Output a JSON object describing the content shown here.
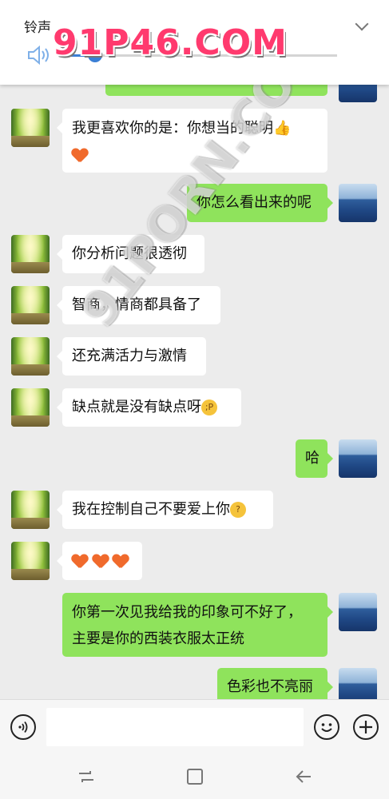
{
  "header": {
    "title": "铃声",
    "playback_progress": 0.12,
    "watermark": "91P46.COM"
  },
  "watermark_diagonal": "91PORN.COM",
  "messages": [
    {
      "side": "left",
      "text": "我更喜欢你的是：你想当的聪明",
      "emoji": [
        "thumbs-up",
        "heart"
      ]
    },
    {
      "side": "right",
      "text": "你怎么看出来的呢"
    },
    {
      "side": "left",
      "text": "你分析问题很透彻"
    },
    {
      "side": "left",
      "text": "智商，情商都具备了"
    },
    {
      "side": "left",
      "text": "还充满活力与激情"
    },
    {
      "side": "left",
      "text": "缺点就是没有缺点呀",
      "emoji": [
        "winking-tongue-face"
      ]
    },
    {
      "side": "right",
      "text": "哈"
    },
    {
      "side": "left",
      "text": "我在控制自己不要爱上你",
      "emoji": [
        "thinking-face"
      ]
    },
    {
      "side": "left",
      "text": "",
      "emoji": [
        "heart",
        "heart",
        "heart"
      ]
    },
    {
      "side": "right",
      "text_lines": [
        "你第一次见我给我的印象可不好了，",
        "主要是你的西装衣服太正统"
      ]
    },
    {
      "side": "right",
      "text": "色彩也不亮丽"
    }
  ],
  "input_bar": {
    "voice_icon": "voice-wave-icon",
    "emoji_icon": "smiley-icon",
    "add_icon": "plus-icon",
    "text_value": ""
  },
  "nav_bar": {
    "icons": [
      "recent-apps-icon",
      "home-icon",
      "back-icon"
    ]
  }
}
